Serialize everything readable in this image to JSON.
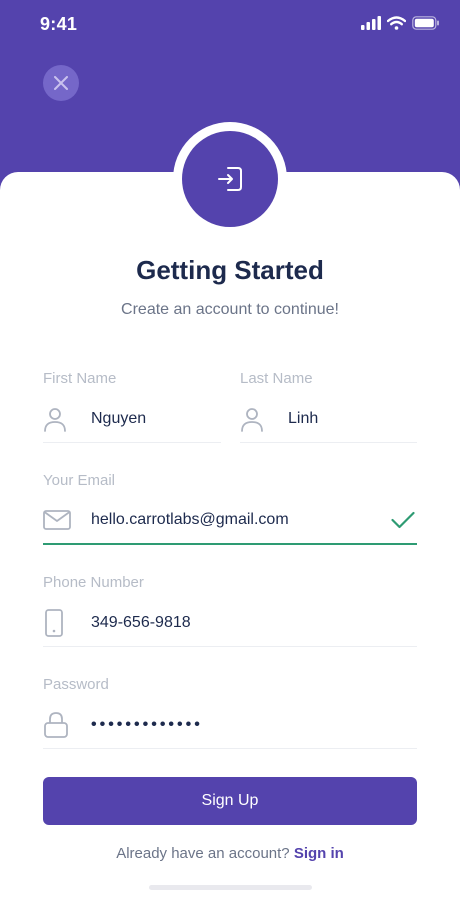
{
  "status_bar": {
    "time": "9:41"
  },
  "header": {
    "title": "Getting Started",
    "subtitle": "Create an account to continue!"
  },
  "form": {
    "first_name": {
      "label": "First Name",
      "value": "Nguyen"
    },
    "last_name": {
      "label": "Last Name",
      "value": "Linh"
    },
    "email": {
      "label": "Your Email",
      "value": "hello.carrotlabs@gmail.com"
    },
    "phone": {
      "label": "Phone Number",
      "value": "349-656-9818"
    },
    "password": {
      "label": "Password",
      "value": "•••••••••••••"
    }
  },
  "actions": {
    "signup_label": "Sign Up",
    "signin_prompt": "Already have an account?",
    "signin_link": "Sign in"
  },
  "colors": {
    "primary": "#5443ad",
    "heading": "#1d2a4d",
    "label": "#b6bcc7",
    "valid": "#2e9b73"
  },
  "icons": [
    "close-icon",
    "login-icon",
    "user-icon",
    "mail-icon",
    "check-icon",
    "phone-icon",
    "lock-icon"
  ]
}
